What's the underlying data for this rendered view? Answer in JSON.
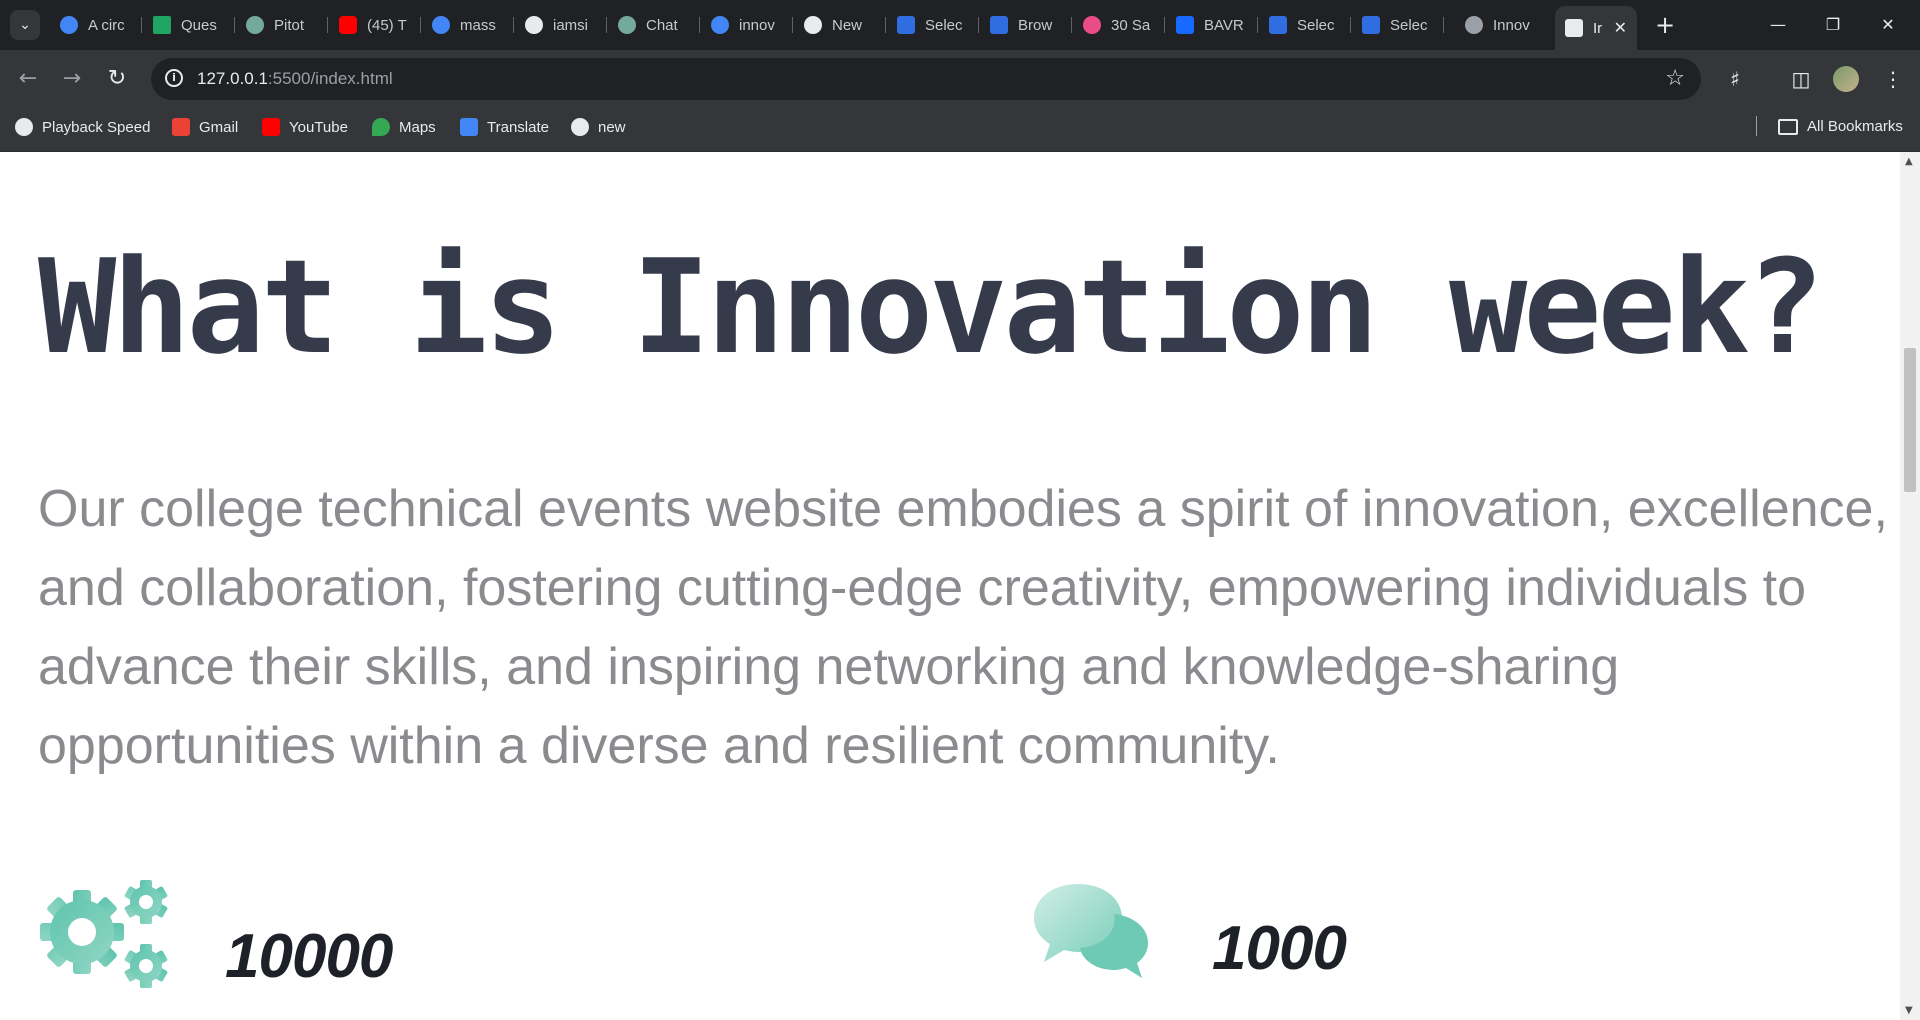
{
  "browser": {
    "tabs": [
      {
        "title": "A circ",
        "color": "#4285f4"
      },
      {
        "title": "Ques",
        "color": "#1fa463"
      },
      {
        "title": "Pitot",
        "color": "#74aa9c"
      },
      {
        "title": "(45) T",
        "color": "#ff0000"
      },
      {
        "title": "mass",
        "color": "#4285f4"
      },
      {
        "title": "iamsi",
        "color": "#e8eaed"
      },
      {
        "title": "Chat",
        "color": "#74aa9c"
      },
      {
        "title": "innov",
        "color": "#4285f4"
      },
      {
        "title": "New",
        "color": "#e8eaed"
      },
      {
        "title": "Selec",
        "color": "#2f6de1"
      },
      {
        "title": "Brow",
        "color": "#2f6de1"
      },
      {
        "title": "30 Sa",
        "color": "#ea4c89"
      },
      {
        "title": "BAVR",
        "color": "#1769ff"
      },
      {
        "title": "Selec",
        "color": "#2f6de1"
      },
      {
        "title": "Selec",
        "color": "#2f6de1"
      },
      {
        "title": "Innov",
        "color": "#9aa0a6"
      },
      {
        "title": "Ir",
        "color": "#e8eaed",
        "active": true
      }
    ],
    "address": {
      "host": "127.0.0.1",
      "rest": ":5500/index.html"
    },
    "bookmarks": [
      {
        "label": "Playback Speed",
        "color": "#e8eaed"
      },
      {
        "label": "Gmail",
        "color": "#ea4335"
      },
      {
        "label": "YouTube",
        "color": "#ff0000"
      },
      {
        "label": "Maps",
        "color": "#34a853"
      },
      {
        "label": "Translate",
        "color": "#4285f4"
      },
      {
        "label": "new",
        "color": "#e8eaed"
      }
    ],
    "all_bookmarks": "All Bookmarks"
  },
  "page": {
    "heading": "What is Innovation week?",
    "description": "Our college technical events website embodies a spirit of innovation, excellence, and collaboration, fostering cutting-edge creativity, empowering individuals to advance their skills, and inspiring networking and knowledge-sharing opportunities within a diverse and resilient community.",
    "stats": [
      {
        "icon": "gears-icon",
        "value": "10000"
      },
      {
        "icon": "chat-bubbles-icon",
        "value": "1000"
      }
    ],
    "accent_color": "#6fcab5",
    "heading_color": "#353b4b",
    "text_color": "#8a8a8f"
  }
}
